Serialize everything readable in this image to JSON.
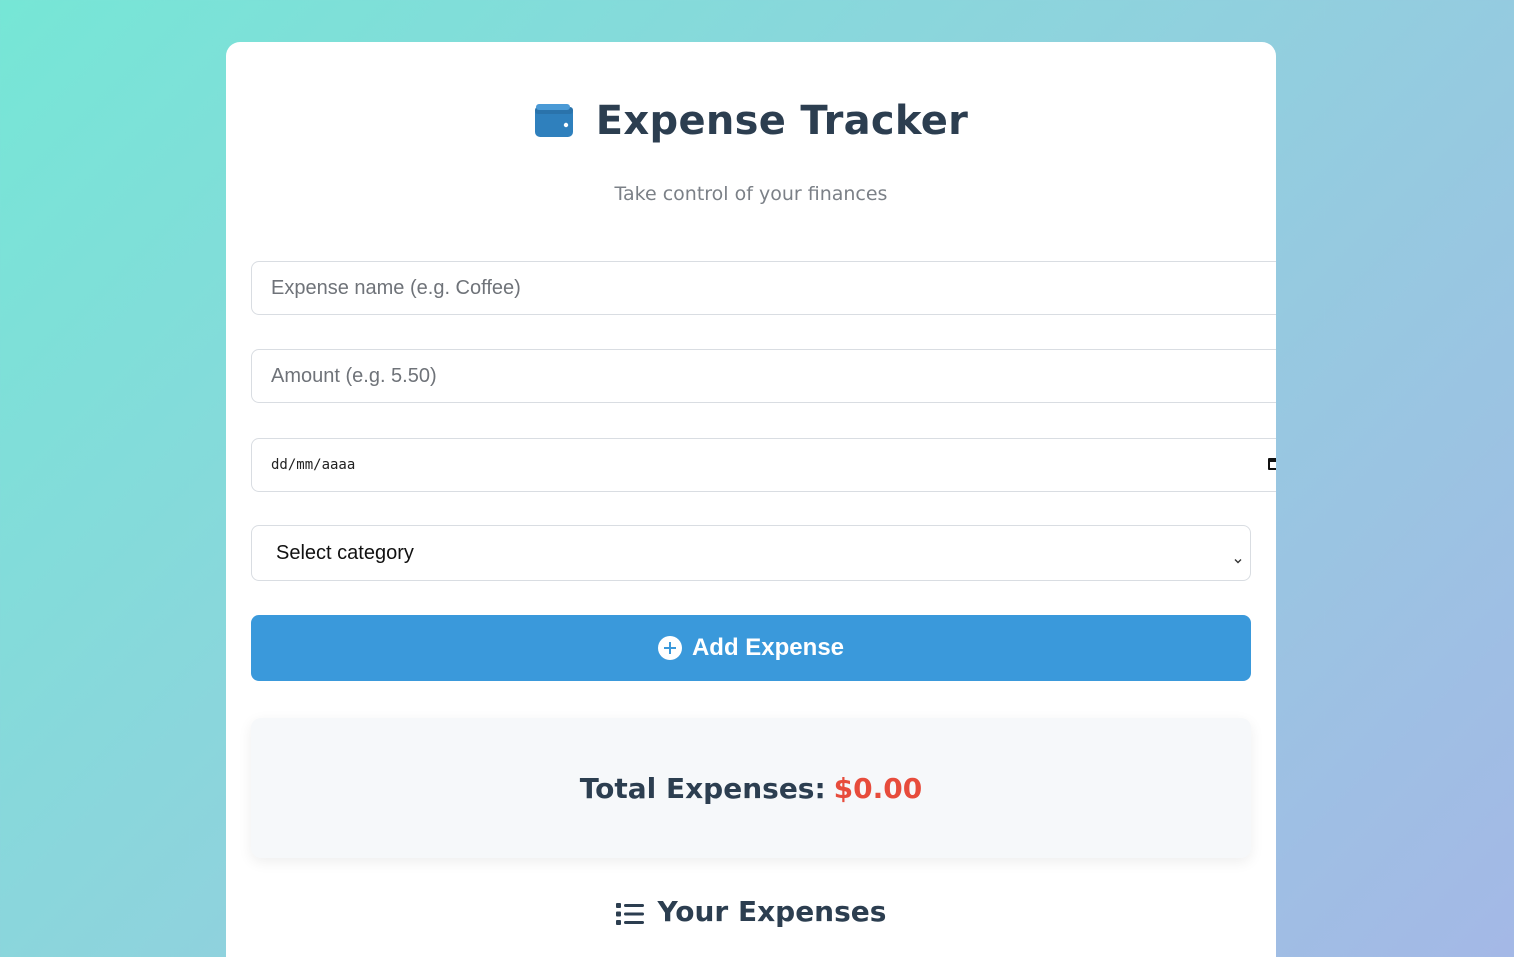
{
  "header": {
    "title": "Expense Tracker",
    "subtitle": "Take control of your finances",
    "icon": "wallet-icon"
  },
  "form": {
    "name_placeholder": "Expense name (e.g. Coffee)",
    "amount_placeholder": "Amount (e.g. 5.50)",
    "date_placeholder": "dd/mm/aaaa",
    "category_selected": "Select category",
    "add_button_label": "Add Expense"
  },
  "summary": {
    "total_label": "Total Expenses:",
    "total_value": "$0.00"
  },
  "list": {
    "heading": "Your Expenses"
  },
  "colors": {
    "accent": "#3a99db",
    "total_amount": "#e74c3c",
    "text_dark": "#2c3e50"
  }
}
